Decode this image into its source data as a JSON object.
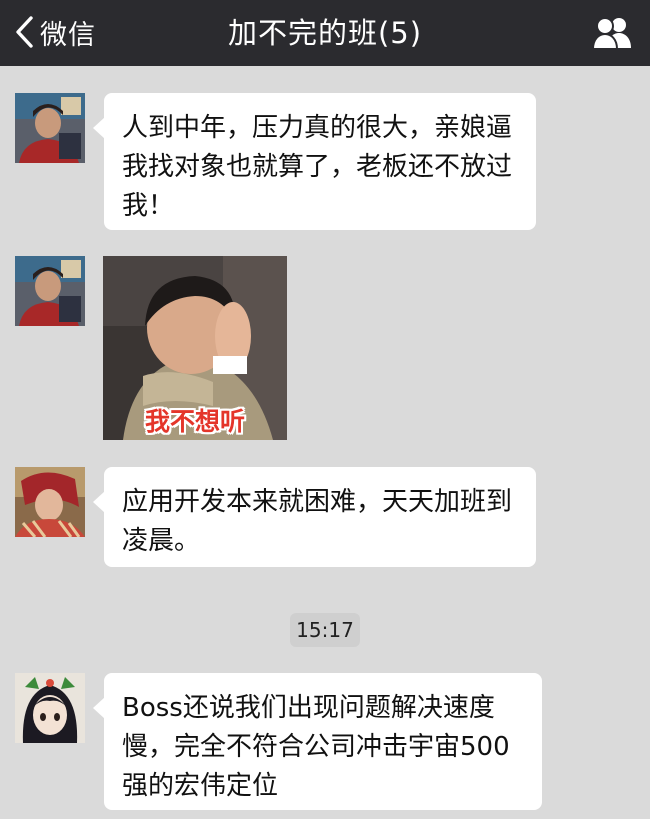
{
  "header": {
    "back_label": "微信",
    "title": "加不完的班(5)"
  },
  "messages": [
    {
      "type": "text",
      "text": "人到中年，压力真的很大，亲娘逼我找对象也就算了，老板还不放过我！"
    },
    {
      "type": "sticker",
      "caption": "我不想听"
    },
    {
      "type": "text",
      "text": "应用开发本来就困难，天天加班到凌晨。"
    },
    {
      "type": "text",
      "text": "Boss还说我们出现问题解决速度慢，完全不符合公司冲击宇宙500强的宏伟定位"
    }
  ],
  "timestamp": "15:17",
  "colors": {
    "nav_bg": "#2b2b2f",
    "chat_bg": "#dadada",
    "bubble_bg": "#ffffff",
    "sticker_caption": "#e4352a"
  },
  "icons": {
    "back": "chevron-left-icon",
    "members": "group-members-icon"
  }
}
